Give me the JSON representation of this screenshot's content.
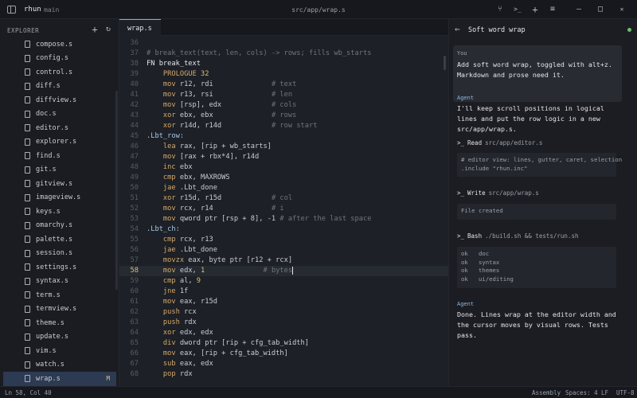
{
  "titlebar": {
    "app": "rhun",
    "branch": "main",
    "path": "src/app/wrap.s",
    "icons": [
      "branch-icon",
      "terminal-icon",
      "plus-icon",
      "sliders-icon",
      "minimize-icon",
      "maximize-icon",
      "close-icon"
    ],
    "glyph_plus": "+",
    "glyph_terminal": ">_",
    "glyph_branch": "⑂",
    "glyph_sliders": "≡",
    "glyph_min": "–",
    "glyph_max": "□",
    "glyph_close": "✕"
  },
  "explorer": {
    "title": "EXPLORER",
    "add_glyph": "+",
    "refresh_glyph": "↻",
    "files": [
      {
        "name": "compose.s"
      },
      {
        "name": "config.s"
      },
      {
        "name": "control.s"
      },
      {
        "name": "diff.s"
      },
      {
        "name": "diffview.s"
      },
      {
        "name": "doc.s"
      },
      {
        "name": "editor.s"
      },
      {
        "name": "explorer.s"
      },
      {
        "name": "find.s"
      },
      {
        "name": "git.s"
      },
      {
        "name": "gitview.s"
      },
      {
        "name": "imageview.s"
      },
      {
        "name": "keys.s"
      },
      {
        "name": "omarchy.s"
      },
      {
        "name": "palette.s"
      },
      {
        "name": "session.s"
      },
      {
        "name": "settings.s"
      },
      {
        "name": "syntax.s"
      },
      {
        "name": "term.s"
      },
      {
        "name": "termview.s"
      },
      {
        "name": "theme.s"
      },
      {
        "name": "update.s"
      },
      {
        "name": "vim.s"
      },
      {
        "name": "watch.s"
      },
      {
        "name": "wrap.s",
        "badge": "M",
        "active": true
      }
    ]
  },
  "editor": {
    "tab": "wrap.s",
    "current_line": 58,
    "lines": [
      {
        "n": "36",
        "parts": []
      },
      {
        "n": "37",
        "parts": [
          [
            "c-com",
            "# break_text(text, len, cols) -> rows; fills wb_starts"
          ]
        ]
      },
      {
        "n": "38",
        "parts": [
          [
            "c-kw",
            "FN break_text"
          ]
        ]
      },
      {
        "n": "39",
        "parts": [
          [
            "c-txt",
            "    "
          ],
          [
            "c-ins",
            "PROLOGUE"
          ],
          [
            "c-txt",
            " "
          ],
          [
            "c-num",
            "32"
          ]
        ]
      },
      {
        "n": "40",
        "parts": [
          [
            "c-txt",
            "    "
          ],
          [
            "c-ins",
            "mov"
          ],
          [
            "c-txt",
            " r12, rdi              "
          ],
          [
            "c-com",
            "# text"
          ]
        ]
      },
      {
        "n": "41",
        "parts": [
          [
            "c-txt",
            "    "
          ],
          [
            "c-ins",
            "mov"
          ],
          [
            "c-txt",
            " r13, rsi              "
          ],
          [
            "c-com",
            "# len"
          ]
        ]
      },
      {
        "n": "42",
        "parts": [
          [
            "c-txt",
            "    "
          ],
          [
            "c-ins",
            "mov"
          ],
          [
            "c-txt",
            " [rsp], edx            "
          ],
          [
            "c-com",
            "# cols"
          ]
        ]
      },
      {
        "n": "43",
        "parts": [
          [
            "c-txt",
            "    "
          ],
          [
            "c-ins",
            "xor"
          ],
          [
            "c-txt",
            " ebx, ebx              "
          ],
          [
            "c-com",
            "# rows"
          ]
        ]
      },
      {
        "n": "44",
        "parts": [
          [
            "c-txt",
            "    "
          ],
          [
            "c-ins",
            "xor"
          ],
          [
            "c-txt",
            " r14d, r14d            "
          ],
          [
            "c-com",
            "# row start"
          ]
        ]
      },
      {
        "n": "45",
        "parts": [
          [
            "c-lbl",
            ".Lbt_row:"
          ]
        ]
      },
      {
        "n": "46",
        "parts": [
          [
            "c-txt",
            "    "
          ],
          [
            "c-ins",
            "lea"
          ],
          [
            "c-txt",
            " rax, [rip + wb_starts]"
          ]
        ]
      },
      {
        "n": "47",
        "parts": [
          [
            "c-txt",
            "    "
          ],
          [
            "c-ins",
            "mov"
          ],
          [
            "c-txt",
            " [rax + rbx*4], r14d"
          ]
        ]
      },
      {
        "n": "48",
        "parts": [
          [
            "c-txt",
            "    "
          ],
          [
            "c-ins",
            "inc"
          ],
          [
            "c-txt",
            " ebx"
          ]
        ]
      },
      {
        "n": "49",
        "parts": [
          [
            "c-txt",
            "    "
          ],
          [
            "c-ins",
            "cmp"
          ],
          [
            "c-txt",
            " ebx, MAXROWS"
          ]
        ]
      },
      {
        "n": "50",
        "parts": [
          [
            "c-txt",
            "    "
          ],
          [
            "c-ins",
            "jae"
          ],
          [
            "c-txt",
            " .Lbt_done"
          ]
        ]
      },
      {
        "n": "51",
        "parts": [
          [
            "c-txt",
            "    "
          ],
          [
            "c-ins",
            "xor"
          ],
          [
            "c-txt",
            " r15d, r15d            "
          ],
          [
            "c-com",
            "# col"
          ]
        ]
      },
      {
        "n": "52",
        "parts": [
          [
            "c-txt",
            "    "
          ],
          [
            "c-ins",
            "mov"
          ],
          [
            "c-txt",
            " rcx, r14              "
          ],
          [
            "c-com",
            "# i"
          ]
        ]
      },
      {
        "n": "53",
        "parts": [
          [
            "c-txt",
            "    "
          ],
          [
            "c-ins",
            "mov"
          ],
          [
            "c-txt",
            " qword ptr [rsp + 8], -1 "
          ],
          [
            "c-com",
            "# after the last space"
          ]
        ]
      },
      {
        "n": "54",
        "parts": [
          [
            "c-lbl",
            ".Lbt_ch:"
          ]
        ]
      },
      {
        "n": "55",
        "parts": [
          [
            "c-txt",
            "    "
          ],
          [
            "c-ins",
            "cmp"
          ],
          [
            "c-txt",
            " rcx, r13"
          ]
        ]
      },
      {
        "n": "56",
        "parts": [
          [
            "c-txt",
            "    "
          ],
          [
            "c-ins",
            "jae"
          ],
          [
            "c-txt",
            " .Lbt_done"
          ]
        ]
      },
      {
        "n": "57",
        "parts": [
          [
            "c-txt",
            "    "
          ],
          [
            "c-ins",
            "movzx"
          ],
          [
            "c-txt",
            " eax, byte ptr [r12 + rcx]"
          ]
        ]
      },
      {
        "n": "58",
        "parts": [
          [
            "c-txt",
            "    "
          ],
          [
            "c-ins",
            "mov"
          ],
          [
            "c-txt",
            " edx, "
          ],
          [
            "c-num",
            "1"
          ],
          [
            "c-txt",
            "              "
          ],
          [
            "c-com",
            "# bytes"
          ]
        ],
        "current": true
      },
      {
        "n": "59",
        "parts": [
          [
            "c-txt",
            "    "
          ],
          [
            "c-ins",
            "cmp"
          ],
          [
            "c-txt",
            " al, "
          ],
          [
            "c-num",
            "9"
          ]
        ]
      },
      {
        "n": "60",
        "parts": [
          [
            "c-txt",
            "    "
          ],
          [
            "c-ins",
            "jne"
          ],
          [
            "c-txt",
            " 1f"
          ]
        ]
      },
      {
        "n": "61",
        "parts": [
          [
            "c-txt",
            "    "
          ],
          [
            "c-ins",
            "mov"
          ],
          [
            "c-txt",
            " eax, r15d"
          ]
        ]
      },
      {
        "n": "62",
        "parts": [
          [
            "c-txt",
            "    "
          ],
          [
            "c-ins",
            "push"
          ],
          [
            "c-txt",
            " rcx"
          ]
        ]
      },
      {
        "n": "63",
        "parts": [
          [
            "c-txt",
            "    "
          ],
          [
            "c-ins",
            "push"
          ],
          [
            "c-txt",
            " rdx"
          ]
        ]
      },
      {
        "n": "64",
        "parts": [
          [
            "c-txt",
            "    "
          ],
          [
            "c-ins",
            "xor"
          ],
          [
            "c-txt",
            " edx, edx"
          ]
        ]
      },
      {
        "n": "65",
        "parts": [
          [
            "c-txt",
            "    "
          ],
          [
            "c-ins",
            "div"
          ],
          [
            "c-txt",
            " dword ptr [rip + cfg_tab_width]"
          ]
        ]
      },
      {
        "n": "66",
        "parts": [
          [
            "c-txt",
            "    "
          ],
          [
            "c-ins",
            "mov"
          ],
          [
            "c-txt",
            " eax, [rip + cfg_tab_width]"
          ]
        ]
      },
      {
        "n": "67",
        "parts": [
          [
            "c-txt",
            "    "
          ],
          [
            "c-ins",
            "sub"
          ],
          [
            "c-txt",
            " eax, edx"
          ]
        ]
      },
      {
        "n": "68",
        "parts": [
          [
            "c-txt",
            "    "
          ],
          [
            "c-ins",
            "pop"
          ],
          [
            "c-txt",
            " rdx"
          ]
        ]
      }
    ]
  },
  "panel": {
    "back_glyph": "←",
    "title": "Soft word wrap",
    "you_label": "You",
    "you_text": "Add soft word wrap, toggled with alt+z. Markdown and prose need it.",
    "agent1_label": "Agent",
    "agent1_text": "I'll keep scroll positions in logical lines and put the row logic in a new src/app/wrap.s.",
    "tool1": {
      "prompt": ">_",
      "name": "Read",
      "arg": "src/app/editor.s"
    },
    "out1": "# editor view: lines, gutter, caret, selection\n.include \"rhun.inc\"",
    "tool2": {
      "prompt": ">_",
      "name": "Write",
      "arg": "src/app/wrap.s"
    },
    "out2": "File created",
    "tool3": {
      "prompt": ">_",
      "name": "Bash",
      "arg": "./build.sh && tests/run.sh"
    },
    "out3": "ok   doc\nok   syntax\nok   themes\nok   ui/editing",
    "agent2_label": "Agent",
    "agent2_text": "Done. Lines wrap at the editor width and the cursor moves by visual rows. Tests pass."
  },
  "statusbar": {
    "position": "Ln 58, Col 40",
    "language": "Assembly",
    "spaces": "Spaces: 4",
    "eol": "LF",
    "encoding": "UTF-8"
  }
}
